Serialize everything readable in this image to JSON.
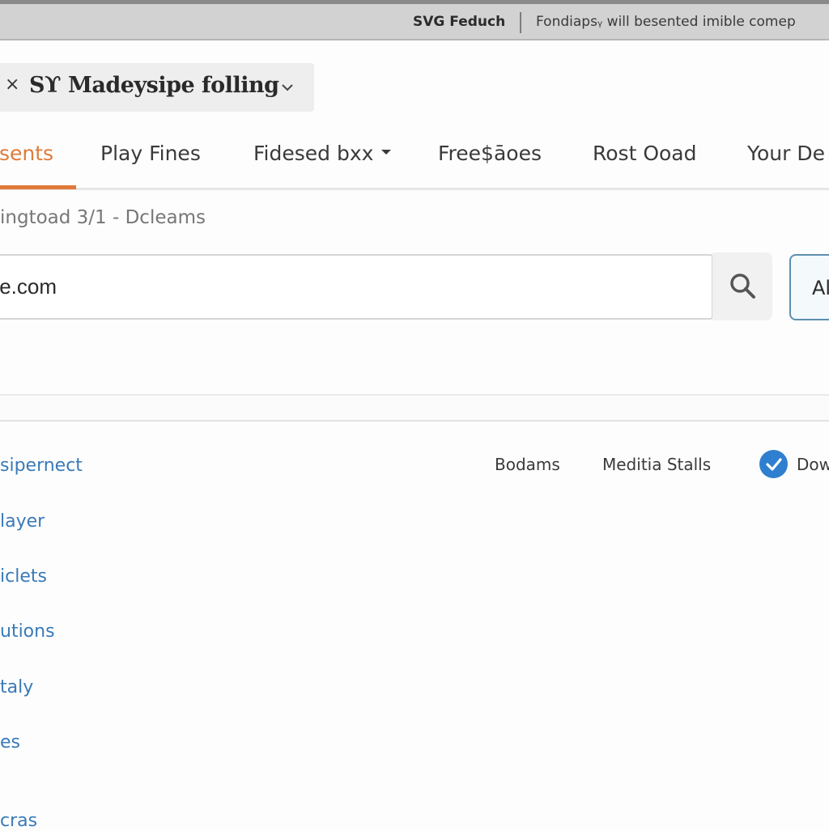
{
  "topbar": {
    "app_name": "SVG Feduch",
    "status_text": "Fondiapsᵧ will besented imible comep"
  },
  "browser_tab": {
    "title": "Sϒ Madeysipe folling",
    "close_icon": "close-icon",
    "chevron_icon": "chevron-down-icon"
  },
  "nav": {
    "tabs": [
      {
        "label": "sents",
        "active": true
      },
      {
        "label": "Play Fines",
        "active": false
      },
      {
        "label": "Fidesed bxx",
        "active": false,
        "has_dropdown": true
      },
      {
        "label": "Free$āoes",
        "active": false
      },
      {
        "label": "Rost Ooad",
        "active": false
      },
      {
        "label": "Your De",
        "active": false
      }
    ],
    "active_color": "#e07b3a"
  },
  "subtitle": "ingtoad 3/1 - Dcleams",
  "search": {
    "value": "te.com",
    "search_icon": "search-icon",
    "alt_button_label": "Al"
  },
  "filters": {
    "items": [
      {
        "label": "Bodams"
      },
      {
        "label": "Meditia Stalls"
      }
    ],
    "checkbox": {
      "label": "Dow",
      "checked": true,
      "icon": "checkmark-icon",
      "color": "#2f7fd0"
    }
  },
  "list": {
    "link_color": "#3a7ab8",
    "items": [
      {
        "label": "sipernect"
      },
      {
        "label": "layer"
      },
      {
        "label": "iclets"
      },
      {
        "label": "utions"
      },
      {
        "label": "taly"
      },
      {
        "label": "es"
      },
      {
        "label": "cras"
      }
    ]
  }
}
